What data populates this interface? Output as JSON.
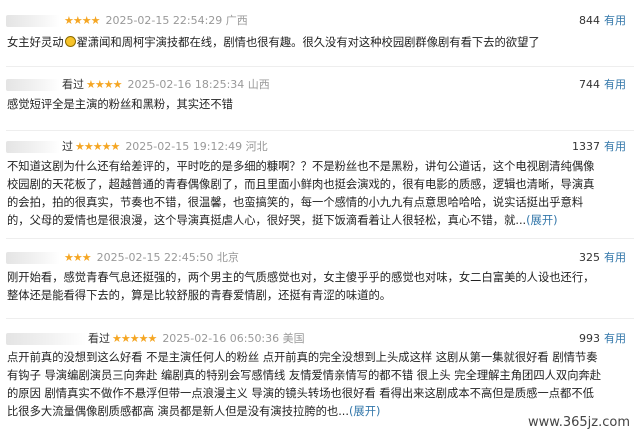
{
  "reviews": [
    {
      "seen": "",
      "stars": "★★★★",
      "time": "2025-02-15 22:54:29",
      "location": "广西",
      "useful_count": "844",
      "useful_label": "有用",
      "text_a": "女主好灵动",
      "text_b": "翟潇闻和周柯宇演技都在线，剧情也很有趣。很久没有对这种校园剧群像剧有看下去的欲望了",
      "expand": ""
    },
    {
      "seen": "看过",
      "stars": "★★★★",
      "time": "2025-02-16 18:25:34",
      "location": "山西",
      "useful_count": "744",
      "useful_label": "有用",
      "text": "感觉短评全是主演的粉丝和黑粉，其实还不错",
      "expand": ""
    },
    {
      "seen": "过",
      "stars": "★★★★★",
      "time": "2025-02-15 19:12:49",
      "location": "河北",
      "useful_count": "1337",
      "useful_label": "有用",
      "text": "不知道这剧为什么还有给差评的，平时吃的是多细的糠啊？？不是粉丝也不是黑粉，讲句公道话，这个电视剧清纯偶像校园剧的天花板了，超越普通的青春偶像剧了，而且里面小鲜肉也挺会演戏的，很有电影的质感，逻辑也清晰，导演真的会拍，拍的很真实，节奏也不错，很温馨，也蛮搞笑的，每一个感情的小九九有点意思哈哈哈，说实话挺出乎意料的，父母的爱情也是很浪漫，这个导演真挺虐人心，很好哭，挺下饭滴看着让人很轻松，真心不错，就...",
      "expand": "(展开)"
    },
    {
      "seen": "",
      "stars": "★★★",
      "time": "2025-02-15 22:45:50",
      "location": "北京",
      "useful_count": "325",
      "useful_label": "有用",
      "text": "刚开始看，感觉青春气息还挺强的，两个男主的气质感觉也对，女主傻乎乎的感觉也对味，女二白富美的人设也还行，整体还是能看得下去的，算是比较舒服的青春爱情剧，还挺有青涩的味道的。",
      "expand": ""
    },
    {
      "seen": "看过",
      "stars": "★★★★★",
      "time": "2025-02-16 06:50:36",
      "location": "美国",
      "useful_count": "993",
      "useful_label": "有用",
      "text": "点开前真的没想到这么好看 不是主演任何人的粉丝 点开前真的完全没想到上头成这样 这剧从第一集就很好看 剧情节奏有钩子 导演编剧演员三向奔赴 编剧真的特别会写感情线 友情爱情亲情写的都不错 很上头 完全理解主角团四人双向奔赴的原因 剧情真实不做作不悬浮但带一点浪漫主义 导演的镜头转场也很好看 看得出来这剧成本不高但是质感一点都不低 比很多大流量偶像剧质感都高 演员都是新人但是没有演技拉胯的也...",
      "expand": "(展开)"
    }
  ],
  "watermark": "www.365jz.com"
}
